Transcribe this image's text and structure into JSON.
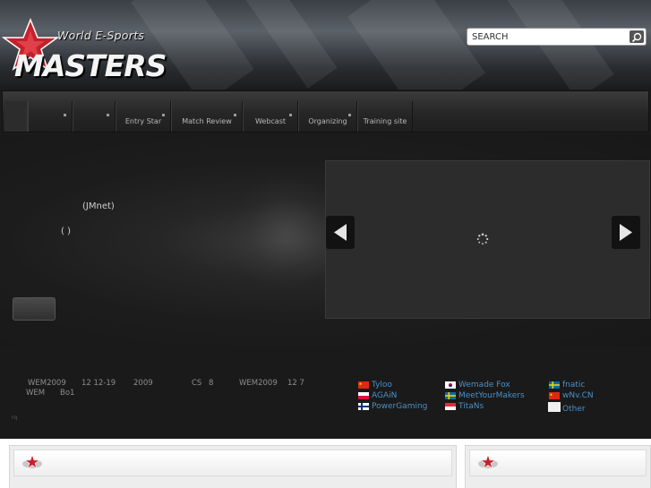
{
  "header": {
    "logo_line1": "World E-Sports",
    "logo_line2": "MASTERS",
    "search_placeholder": "SEARCH"
  },
  "nav": {
    "items": [
      {
        "label": ""
      },
      {
        "label": ""
      },
      {
        "label": "Entry Star"
      },
      {
        "label": "Match Review"
      },
      {
        "label": "Webcast"
      },
      {
        "label": "Organizing"
      },
      {
        "label": "Training site"
      }
    ]
  },
  "feature": {
    "line1": "(JMnet)",
    "line2": "( )"
  },
  "news": {
    "row1": [
      "WEM2009",
      "12 12-19",
      "2009",
      "CS",
      "8",
      "WEM2009",
      "12 7"
    ],
    "row2": [
      "WEM",
      "Bo1"
    ],
    "footnote": "rq"
  },
  "teams": [
    {
      "name": "Tyloo",
      "flag": "china"
    },
    {
      "name": "AGAiN",
      "flag": "poland"
    },
    {
      "name": "PowerGaming",
      "flag": "finland"
    },
    {
      "name": "Wemade Fox",
      "flag": "korea"
    },
    {
      "name": "MeetYourMakers",
      "flag": "sweden"
    },
    {
      "name": "TitaNs",
      "flag": "singapore"
    },
    {
      "name": "fnatic",
      "flag": "sweden"
    },
    {
      "name": "wNv.CN",
      "flag": "china"
    },
    {
      "name": "Other",
      "flag": "blank"
    }
  ],
  "colors": {
    "accent_red": "#c0202a",
    "team_link": "#4a90c8"
  }
}
